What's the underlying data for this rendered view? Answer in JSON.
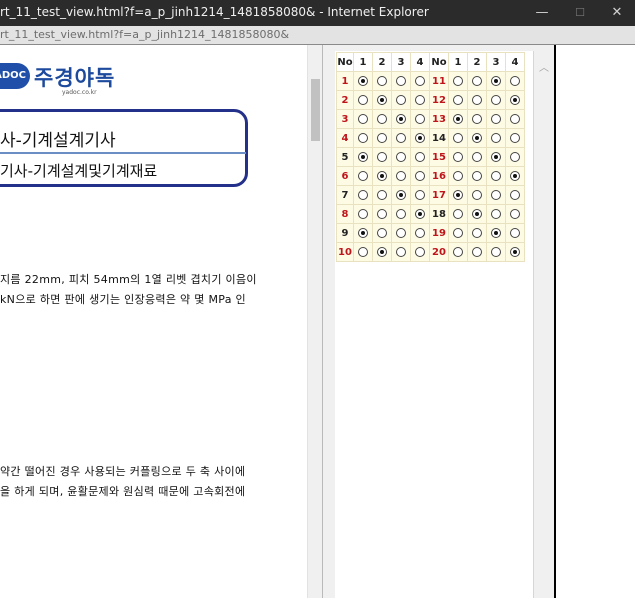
{
  "window": {
    "title": "rt_11_test_view.html?f=a_p_jinh1214_1481858080& - Internet Explorer",
    "minimize": "—",
    "maximize": "☐",
    "close": "✕"
  },
  "address": {
    "url": "rt_11_test_view.html?f=a_p_jinh1214_1481858080&"
  },
  "document": {
    "logo_badge": "YADOC",
    "logo_text": "주경야독",
    "logo_sub": "yadoc.co.kr",
    "exam_title": "사-기계설계기사",
    "exam_subject": "기사-기계설계및기계재료",
    "question1_line1": "지름 22mm, 피치 54mm의 1열 리벳 겹치기 이음이",
    "question1_line2": "kN으로 하면 판에 생기는 인장응력은 약 몇 MPa 인",
    "question2_line1": "약간 떨어진 경우 사용되는 커플링으로 두 축 사이에",
    "question2_line2": "을 하게 되며, 윤활문제와 원심력 때문에 고속회전에"
  },
  "answers": {
    "headers": [
      "No",
      "1",
      "2",
      "3",
      "4",
      "No",
      "1",
      "2",
      "3",
      "4"
    ],
    "rows": [
      {
        "left_no": "1",
        "left_sel": 1,
        "left_red": true,
        "right_no": "11",
        "right_sel": 3,
        "right_red": true
      },
      {
        "left_no": "2",
        "left_sel": 2,
        "left_red": true,
        "right_no": "12",
        "right_sel": 4,
        "right_red": true
      },
      {
        "left_no": "3",
        "left_sel": 3,
        "left_red": true,
        "right_no": "13",
        "right_sel": 1,
        "right_red": true
      },
      {
        "left_no": "4",
        "left_sel": 4,
        "left_red": true,
        "right_no": "14",
        "right_sel": 2,
        "right_red": false
      },
      {
        "left_no": "5",
        "left_sel": 1,
        "left_red": false,
        "right_no": "15",
        "right_sel": 3,
        "right_red": true
      },
      {
        "left_no": "6",
        "left_sel": 2,
        "left_red": true,
        "right_no": "16",
        "right_sel": 4,
        "right_red": true
      },
      {
        "left_no": "7",
        "left_sel": 3,
        "left_red": false,
        "right_no": "17",
        "right_sel": 1,
        "right_red": true
      },
      {
        "left_no": "8",
        "left_sel": 4,
        "left_red": true,
        "right_no": "18",
        "right_sel": 2,
        "right_red": false
      },
      {
        "left_no": "9",
        "left_sel": 1,
        "left_red": false,
        "right_no": "19",
        "right_sel": 3,
        "right_red": true
      },
      {
        "left_no": "10",
        "left_sel": 2,
        "left_red": true,
        "right_no": "20",
        "right_sel": 4,
        "right_red": true
      }
    ]
  }
}
